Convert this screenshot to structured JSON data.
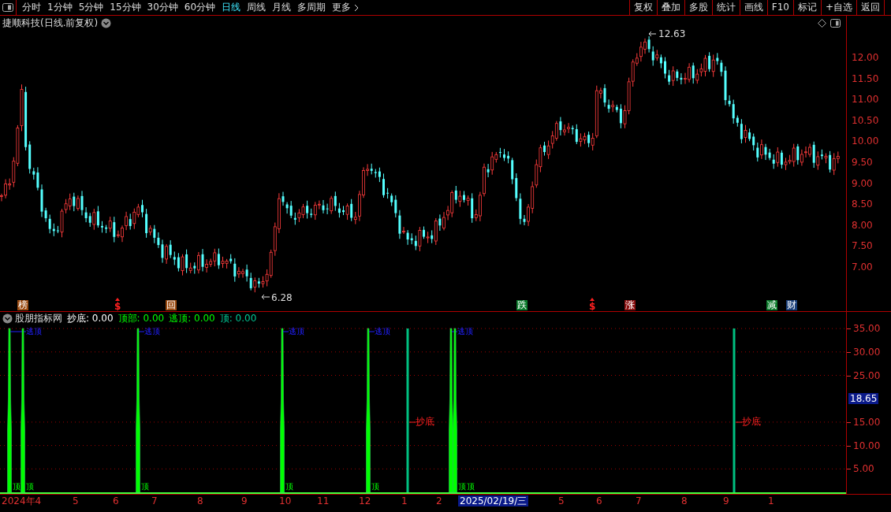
{
  "toolbar": {
    "periods": [
      {
        "label": "分时",
        "selected": false
      },
      {
        "label": "1分钟",
        "selected": false
      },
      {
        "label": "5分钟",
        "selected": false
      },
      {
        "label": "15分钟",
        "selected": false
      },
      {
        "label": "30分钟",
        "selected": false
      },
      {
        "label": "60分钟",
        "selected": false
      },
      {
        "label": "日线",
        "selected": true
      },
      {
        "label": "周线",
        "selected": false
      },
      {
        "label": "月线",
        "selected": false
      },
      {
        "label": "多周期",
        "selected": false
      },
      {
        "label": "更多",
        "selected": false
      }
    ],
    "actions": [
      "复权",
      "叠加",
      "多股",
      "统计",
      "画线",
      "F10",
      "标记",
      "+自选",
      "返回"
    ]
  },
  "main_chart": {
    "title": "捷顺科技(日线.前复权)",
    "price_axis": [
      "12.00",
      "11.50",
      "11.00",
      "10.50",
      "10.00",
      "9.50",
      "9.00",
      "8.50",
      "8.00",
      "7.50",
      "7.00"
    ],
    "high_label": "12.63",
    "low_label": "6.28",
    "markers": [
      {
        "text": "榜",
        "kind": "tag",
        "color": "#9a4a10"
      },
      {
        "text": "$",
        "kind": "dollar"
      },
      {
        "text": "回",
        "kind": "tag",
        "color": "#9a4a10"
      },
      {
        "text": "跌",
        "kind": "tag",
        "color": "#0a7a2a"
      },
      {
        "text": "$",
        "kind": "dollar"
      },
      {
        "text": "涨",
        "kind": "tag",
        "color": "#8a1010"
      },
      {
        "text": "减",
        "kind": "tag",
        "color": "#0a7a2a"
      },
      {
        "text": "财",
        "kind": "tag",
        "color": "#1a3f7a"
      }
    ]
  },
  "indicator": {
    "name": "股朋指标网",
    "lines": [
      {
        "label": "抄底: 0.00",
        "color": "#ffffff"
      },
      {
        "label": "顶部: 0.00",
        "color": "#00ff00"
      },
      {
        "label": "逃顶: 0.00",
        "color": "#00ff00"
      },
      {
        "label": "顶: 0.00",
        "color": "#00c896"
      }
    ],
    "axis": [
      "35.00",
      "30.00",
      "25.00",
      "15.00",
      "10.00",
      "5.00"
    ],
    "current_value": "18.65",
    "signals": [
      {
        "kind": "top",
        "top_label": "逃顶",
        "bottom_label": "顶"
      },
      {
        "kind": "top",
        "bottom_label": "顶"
      },
      {
        "kind": "top",
        "top_label": "逃顶",
        "bottom_label": "顶"
      },
      {
        "kind": "top",
        "top_label": "逃顶",
        "bottom_label": "顶"
      },
      {
        "kind": "top",
        "top_label": "逃顶",
        "bottom_label": "顶"
      },
      {
        "kind": "bottom",
        "label": "抄底"
      },
      {
        "kind": "top",
        "top_label": "逃顶",
        "bottom_label": "顶"
      },
      {
        "kind": "top",
        "bottom_label": "顶"
      },
      {
        "kind": "bottom",
        "label": "抄底"
      }
    ]
  },
  "date_axis": {
    "labels": [
      {
        "text": "2024年4",
        "selected": false
      },
      {
        "text": "5",
        "selected": false
      },
      {
        "text": "6",
        "selected": false
      },
      {
        "text": "7",
        "selected": false
      },
      {
        "text": "8",
        "selected": false
      },
      {
        "text": "9",
        "selected": false
      },
      {
        "text": "10",
        "selected": false
      },
      {
        "text": "11",
        "selected": false
      },
      {
        "text": "12",
        "selected": false
      },
      {
        "text": "1",
        "selected": false
      },
      {
        "text": "2",
        "selected": false
      },
      {
        "text": "2025/02/19/三",
        "selected": true
      },
      {
        "text": "5",
        "selected": false
      },
      {
        "text": "6",
        "selected": false
      },
      {
        "text": "7",
        "selected": false
      },
      {
        "text": "8",
        "selected": false
      },
      {
        "text": "9",
        "selected": false
      },
      {
        "text": "1",
        "selected": false
      }
    ]
  }
}
